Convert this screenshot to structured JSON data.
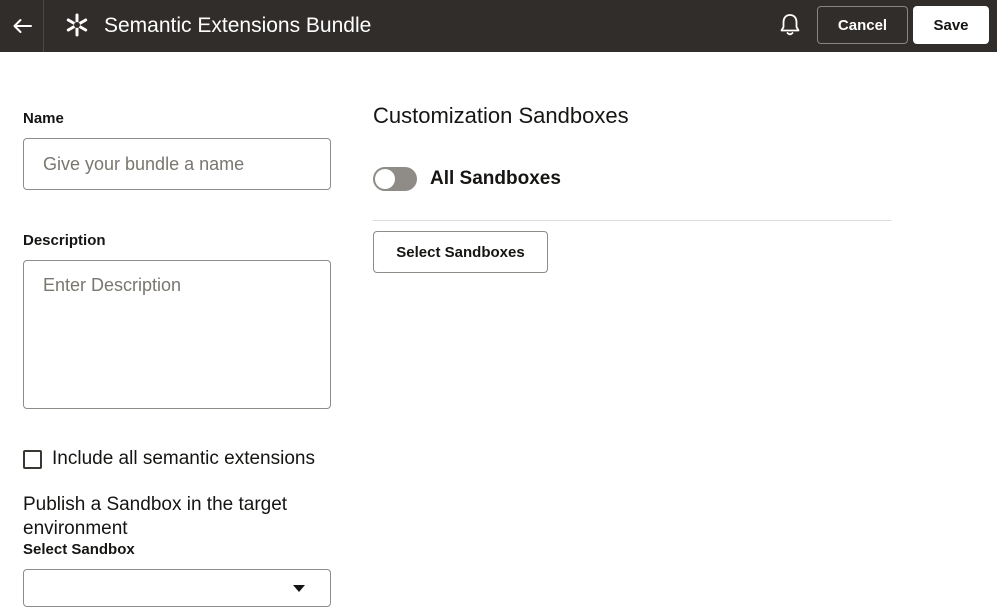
{
  "header": {
    "back_icon": "arrow-left-icon",
    "app_icon": "snowflake-icon",
    "title": "Semantic Extensions Bundle",
    "notification_icon": "bell-icon",
    "cancel_label": "Cancel",
    "save_label": "Save",
    "background_color": "#312d2a"
  },
  "form": {
    "name_label": "Name",
    "name_placeholder": "Give your bundle a name",
    "name_value": "",
    "description_label": "Description",
    "description_placeholder": "Enter Description",
    "description_value": "",
    "include_all_label": "Include all semantic extensions",
    "include_all_checked": false,
    "publish_text": "Publish a Sandbox in the target environment",
    "select_sandbox_label": "Select Sandbox",
    "select_sandbox_value": ""
  },
  "sandboxes": {
    "title": "Customization Sandboxes",
    "all_sandboxes_label": "All Sandboxes",
    "all_sandboxes_on": false,
    "select_button_label": "Select Sandboxes"
  }
}
